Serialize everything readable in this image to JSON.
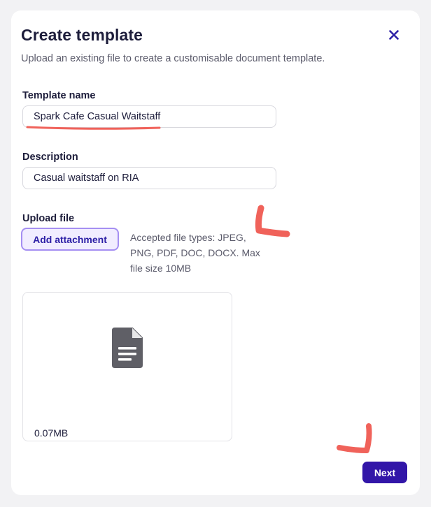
{
  "modal": {
    "title": "Create template",
    "subtitle": "Upload an existing file to create a customisable document template."
  },
  "close_icon": "close-icon",
  "template_name": {
    "label": "Template name",
    "value": "Spark Cafe Casual Waitstaff"
  },
  "description": {
    "label": "Description",
    "value": "Casual waitstaff on RIA"
  },
  "upload": {
    "label": "Upload file",
    "button_label": "Add attachment",
    "help_text": "Accepted file types: JPEG, PNG, PDF, DOC, DOCX. Max file size 10MB"
  },
  "file": {
    "icon": "document-icon",
    "size": "0.07MB"
  },
  "footer": {
    "next_label": "Next"
  },
  "colors": {
    "accent": "#3216a8",
    "accent_light": "#f1edff",
    "accent_border": "#a58ff2",
    "annotation": "#f0625a",
    "icon_gray": "#5f5f66"
  }
}
